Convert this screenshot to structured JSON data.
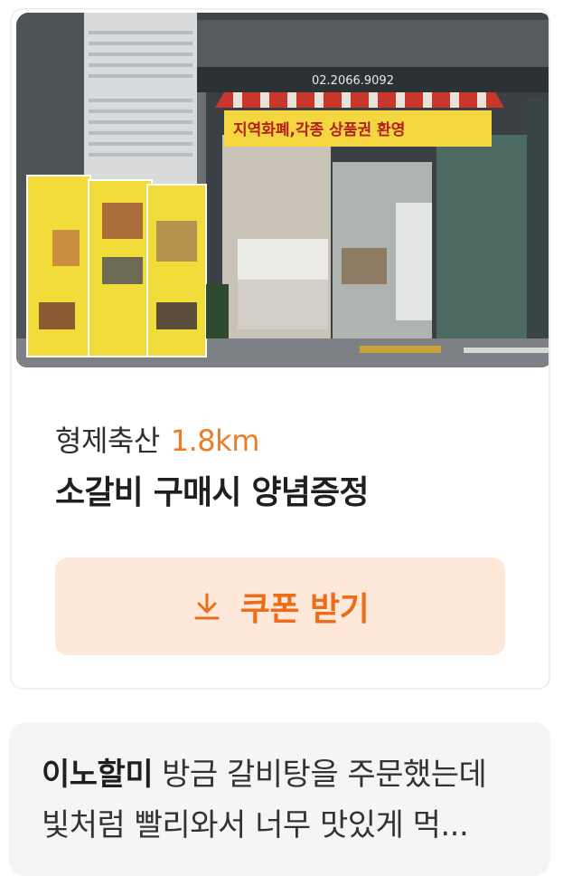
{
  "coupon": {
    "photo": {
      "phone": "02.2066.9092",
      "awning_text": "지역화폐,각종 상품권 환영"
    },
    "store_name": "형제축산",
    "distance": "1.8km",
    "offer_title": "소갈비 구매시 양념증정",
    "button_label": "쿠폰 받기",
    "button_icon": "download-icon"
  },
  "review": {
    "author": "이노할미",
    "text": "방금 갈비탕을 주문했는데 빛처럼 빨리와서 너무 맛있게 먹..."
  },
  "colors": {
    "accent": "#f07b27",
    "button_bg": "#fde8da",
    "review_bg": "#f4f5f7"
  }
}
